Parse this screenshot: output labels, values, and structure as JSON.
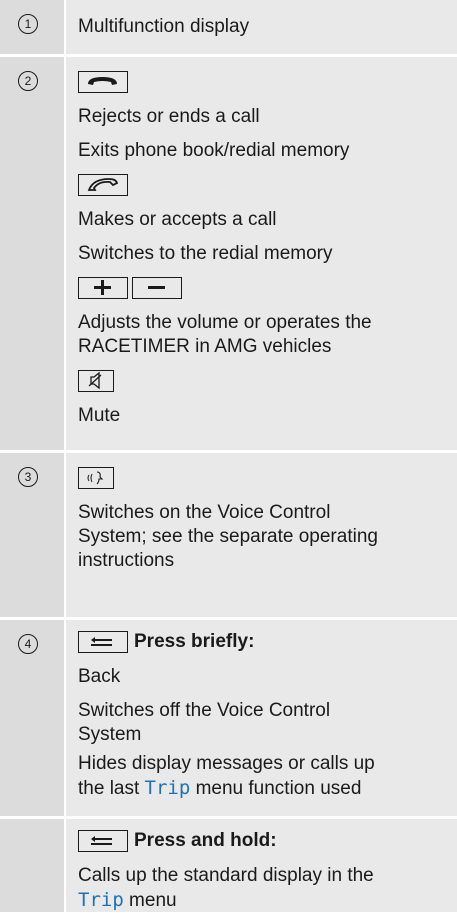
{
  "rows": {
    "r1": {
      "num": "1",
      "text": "Multifunction display"
    },
    "r2": {
      "num": "2",
      "end_call_icon": "end-call-icon",
      "end_lines": [
        "Rejects or ends a call",
        "Exits phone book/redial memory"
      ],
      "accept_call_icon": "accept-call-icon",
      "accept_lines": [
        "Makes or accepts a call",
        "Switches to the redial memory"
      ],
      "plus_icon": "plus-icon",
      "minus_icon": "minus-icon",
      "volume_lines": [
        "Adjusts the volume or operates the",
        "RACETIMER in AMG vehicles"
      ],
      "mute_icon": "mute-icon",
      "mute_text": "Mute"
    },
    "r3": {
      "num": "3",
      "voice_icon": "voice-control-icon",
      "lines": [
        "Switches on the Voice Control",
        "System; see the separate operating",
        "instructions"
      ]
    },
    "r4": {
      "num": "4",
      "back_icon": "back-icon",
      "press_briefly": "Press briefly:",
      "back_text": "Back",
      "switch_off_lines": [
        "Switches off the Voice Control",
        "System"
      ],
      "hides_line1": "Hides display messages or calls up",
      "hides_pre": "the last ",
      "hides_trip": "Trip",
      "hides_post": " menu function used"
    },
    "r5": {
      "back_icon": "back-icon",
      "press_hold": "Press and hold:",
      "line1": "Calls up the standard display in the",
      "trip": "Trip",
      "post": " menu"
    }
  }
}
